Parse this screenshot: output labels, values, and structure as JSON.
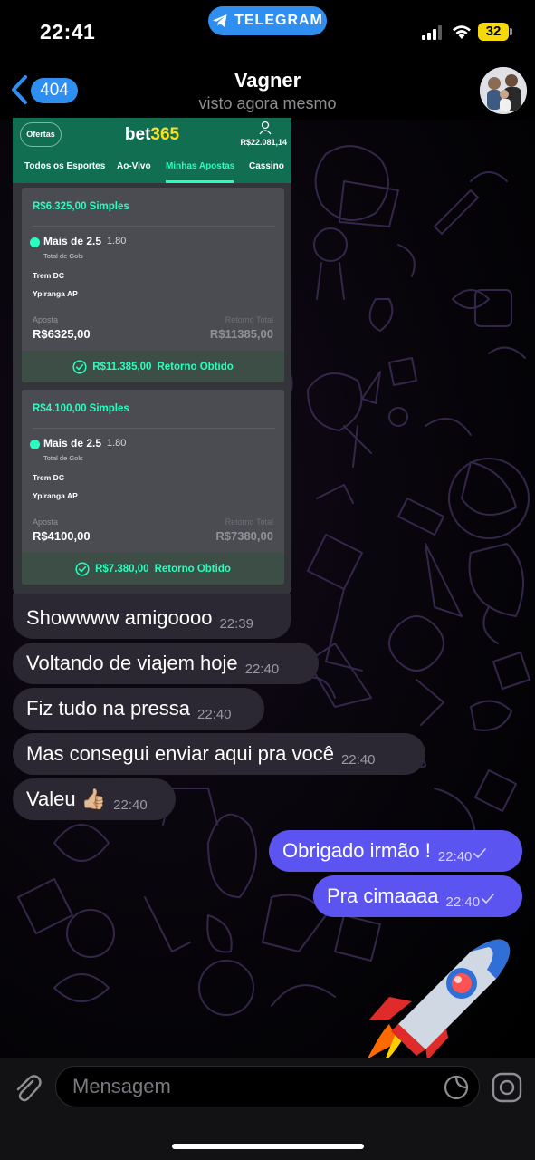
{
  "status_bar": {
    "time": "22:41",
    "app_pill": "TELEGRAM",
    "battery": "32"
  },
  "header": {
    "back_count": "404",
    "chat_name": "Vagner",
    "chat_status": "visto agora mesmo"
  },
  "bet_screenshot": {
    "ofertas": "Ofertas",
    "logo_bet": "bet",
    "logo_365": "365",
    "balance": "R$22.081,14",
    "tabs": [
      "Todos os Esportes",
      "Ao-Vivo",
      "Minhas Apostas",
      "Cassino"
    ],
    "active_tab": "Minhas Apostas",
    "cards": [
      {
        "title": "R$6.325,00 Simples",
        "selection": "Mais de 2.5",
        "odds": "1.80",
        "market": "Total de Gols",
        "team1": "Trem DC",
        "team2": "Ypiranga AP",
        "stake_label": "Aposta",
        "stake": "R$6325,00",
        "return_label": "Retorno Total",
        "return_total": "R$11385,00",
        "result_amount": "R$11.385,00",
        "result_label": "Retorno Obtido"
      },
      {
        "title": "R$4.100,00 Simples",
        "selection": "Mais de 2.5",
        "odds": "1.80",
        "market": "Total de Gols",
        "team1": "Trem DC",
        "team2": "Ypiranga AP",
        "stake_label": "Aposta",
        "stake": "R$4100,00",
        "return_label": "Retorno Total",
        "return_total": "R$7380,00",
        "result_amount": "R$7.380,00",
        "result_label": "Retorno Obtido"
      }
    ]
  },
  "messages": [
    {
      "direction": "in",
      "text": "Showwww amigoooo",
      "time": "22:39"
    },
    {
      "direction": "in",
      "text": "Voltando de viajem hoje",
      "time": "22:40"
    },
    {
      "direction": "in",
      "text": "Fiz tudo na pressa",
      "time": "22:40"
    },
    {
      "direction": "in",
      "text": "Mas consegui enviar aqui pra você",
      "time": "22:40"
    },
    {
      "direction": "in",
      "text": "Valeu 👍🏼",
      "time": "22:40"
    },
    {
      "direction": "out",
      "text": "Obrigado irmão !",
      "time": "22:40",
      "status": "read"
    },
    {
      "direction": "out",
      "text": "Pra cimaaaa",
      "time": "22:40",
      "status": "read"
    }
  ],
  "sticker": {
    "icon": "rocket-sticker"
  },
  "composer": {
    "placeholder": "Mensagem"
  },
  "colors": {
    "accent": "#2f8ff0",
    "outgoing_bubble": "#5b54f0",
    "incoming_bubble": "#2b2733",
    "bet365_green": "#126e51",
    "bet365_accent": "#26ffbe"
  }
}
